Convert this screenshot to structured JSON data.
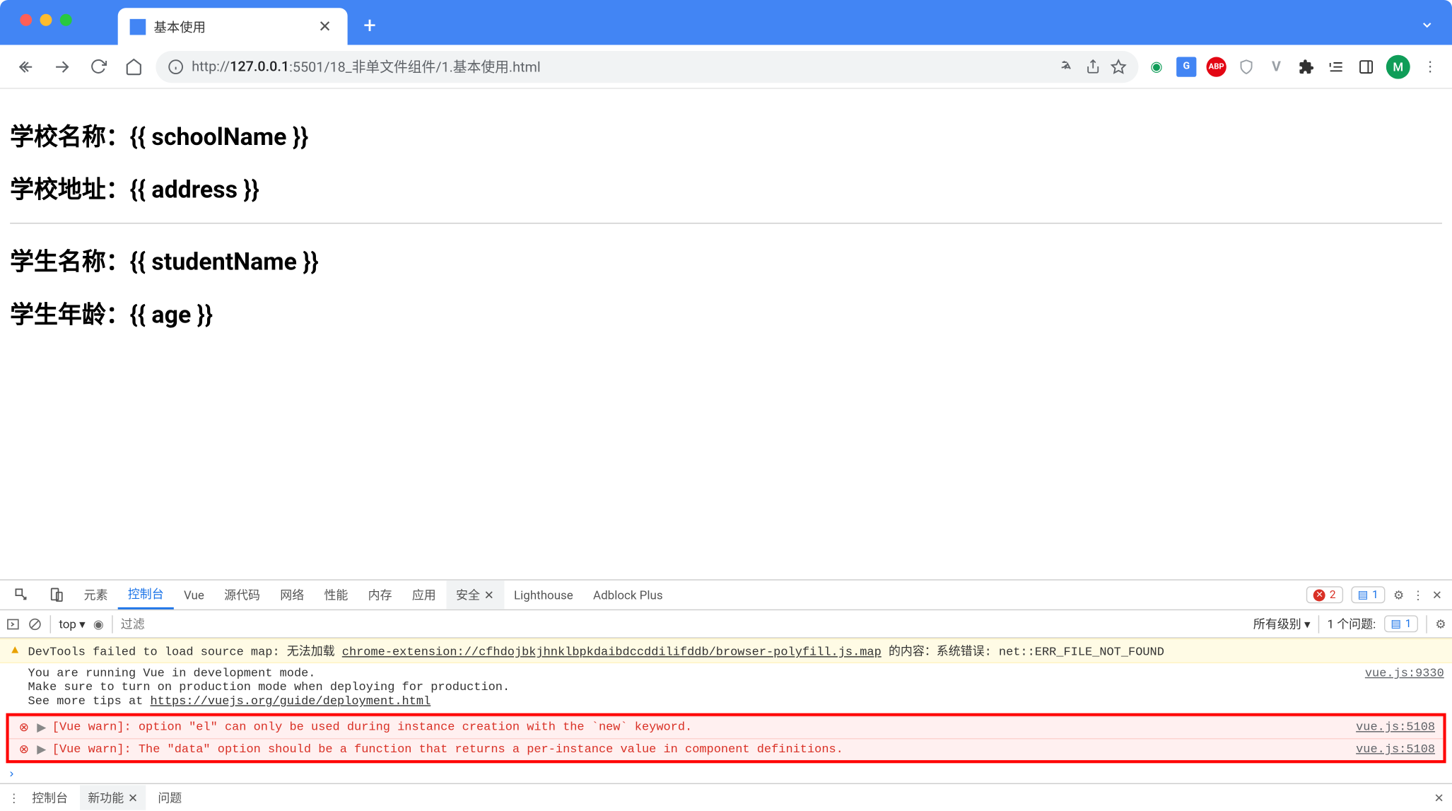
{
  "window": {
    "tab_title": "基本使用",
    "new_tab_tooltip": "新建标签页"
  },
  "address": {
    "scheme": "http://",
    "host": "127.0.0.1",
    "port_path": ":5501/18_非单文件组件/1.基本使用.html"
  },
  "avatar_letter": "M",
  "page": {
    "heading1": "学校名称：{{ schoolName }}",
    "heading2": "学校地址：{{ address }}",
    "heading3": "学生名称：{{ studentName }}",
    "heading4": "学生年龄：{{ age }}"
  },
  "devtools": {
    "tabs": [
      "元素",
      "控制台",
      "Vue",
      "源代码",
      "网络",
      "性能",
      "内存",
      "应用",
      "安全",
      "Lighthouse",
      "Adblock Plus"
    ],
    "active_tab": "控制台",
    "secondary_active": "安全",
    "error_count": "2",
    "message_count": "1",
    "filter": {
      "context": "top",
      "placeholder": "过滤",
      "level": "所有级别",
      "issues_label": "1 个问题:",
      "issues_count": "1"
    },
    "messages": {
      "warn_prefix": "DevTools failed to load source map: 无法加载 ",
      "warn_url": "chrome-extension://cfhdojbkjhnklbpkdaibdccddilifddb/browser-polyfill.js.map",
      "warn_suffix": " 的内容：系统错误: net::ERR_FILE_NOT_FOUND",
      "info_line1": "You are running Vue in development mode.",
      "info_line2": "Make sure to turn on production mode when deploying for production.",
      "info_line3_pre": "See more tips at ",
      "info_line3_link": "https://vuejs.org/guide/deployment.html",
      "info_src": "vue.js:9330",
      "err1": "[Vue warn]: option \"el\" can only be used during instance creation with the `new` keyword.",
      "err1_src": "vue.js:5108",
      "err2": "[Vue warn]: The \"data\" option should be a function that returns a per-instance value in component definitions.",
      "err2_src": "vue.js:5108"
    },
    "drawer": {
      "console": "控制台",
      "whatsnew": "新功能",
      "issues": "问题"
    }
  }
}
